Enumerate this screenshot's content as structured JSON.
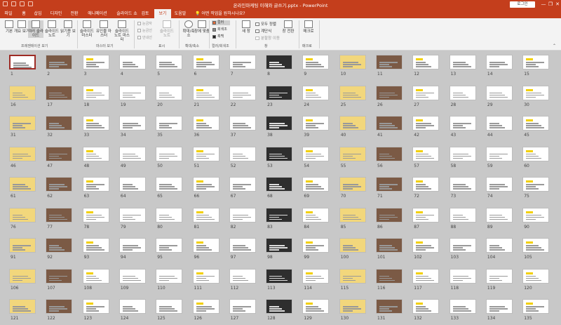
{
  "window": {
    "title": "온라인마케팅 이해와 글쓰기.pptx  -  PowerPoint",
    "login_label": "로그인",
    "minimize": "—",
    "restore": "❐",
    "close": "✕"
  },
  "tabs": [
    {
      "label": "파일",
      "active": false
    },
    {
      "label": "홈",
      "active": false
    },
    {
      "label": "삽입",
      "active": false
    },
    {
      "label": "디자인",
      "active": false
    },
    {
      "label": "전환",
      "active": false
    },
    {
      "label": "애니메이션",
      "active": false
    },
    {
      "label": "슬라이드 쇼",
      "active": false
    },
    {
      "label": "검토",
      "active": false
    },
    {
      "label": "보기",
      "active": true
    },
    {
      "label": "도움말",
      "active": false
    }
  ],
  "tell_me": "어떤 작업을 원하시나요?",
  "ribbon": {
    "presentation_views": {
      "buttons": [
        "기본",
        "개요 보기",
        "여러 슬라이드",
        "슬라이드 노트",
        "읽기용 보기"
      ],
      "label": "프레젠테이션 보기"
    },
    "master_views": {
      "buttons": [
        "슬라이드 마스터",
        "유인물 마스터",
        "슬라이드 노트 마스터"
      ],
      "label": "마스터 보기"
    },
    "show": {
      "checks": [
        "눈금자",
        "눈금선",
        "안내선"
      ],
      "button": "슬라이드 노트",
      "label": "표시"
    },
    "zoom": {
      "buttons": [
        "확대/축소",
        "창에 맞춤"
      ],
      "label": "확대/축소"
    },
    "color": {
      "options": [
        "컬러",
        "회색조",
        "흑백"
      ],
      "label": "컬러/회색조"
    },
    "window": {
      "new_window": "새 창",
      "items": [
        "모두 정렬",
        "계단식",
        "분할창 이동"
      ],
      "switch": "창 전환",
      "label": "창"
    },
    "macro": {
      "button": "매크로",
      "label": "매크로"
    }
  },
  "slides": {
    "selected": 1,
    "count": 135
  }
}
